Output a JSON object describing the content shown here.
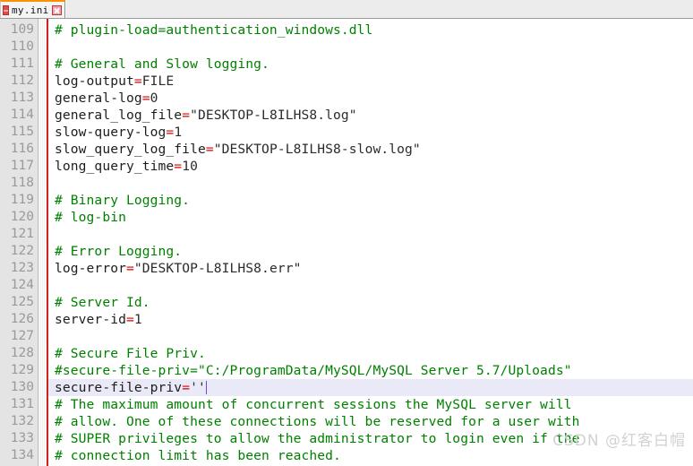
{
  "window": {
    "app": "text-editor",
    "title": "my.ini"
  },
  "tabbar": {
    "tabs": [
      {
        "label": "my.ini",
        "icon": "document-icon",
        "close_icon": "close-icon",
        "active": true
      }
    ]
  },
  "editor": {
    "first_line_number": 109,
    "current_line_number": 130,
    "gutter_line_numbers": [
      "109",
      "110",
      "111",
      "112",
      "113",
      "114",
      "115",
      "116",
      "117",
      "118",
      "119",
      "120",
      "121",
      "122",
      "123",
      "124",
      "125",
      "126",
      "127",
      "128",
      "129",
      "130",
      "131",
      "132",
      "133",
      "134"
    ],
    "colors": {
      "comment": "#008000",
      "operator": "#d40000",
      "text": "#1d1d1d",
      "current_line_bg": "#e9e9f7",
      "caret": "#6a4de0",
      "gutter_bg": "#e4e4e4",
      "gutter_text": "#9a9a9a",
      "margin_marker": "#d02020",
      "tab_accent": "#ff9000"
    },
    "lines": [
      {
        "n": "109",
        "tokens": [
          {
            "t": "comment",
            "s": "# plugin-load=authentication_windows.dll"
          }
        ]
      },
      {
        "n": "110",
        "tokens": [
          {
            "t": "blank",
            "s": ""
          }
        ]
      },
      {
        "n": "111",
        "tokens": [
          {
            "t": "comment",
            "s": "# General and Slow logging."
          }
        ]
      },
      {
        "n": "112",
        "tokens": [
          {
            "t": "key",
            "s": "log-output"
          },
          {
            "t": "eq",
            "s": "="
          },
          {
            "t": "val",
            "s": "FILE"
          }
        ]
      },
      {
        "n": "113",
        "tokens": [
          {
            "t": "key",
            "s": "general-log"
          },
          {
            "t": "eq",
            "s": "="
          },
          {
            "t": "val",
            "s": "0"
          }
        ]
      },
      {
        "n": "114",
        "tokens": [
          {
            "t": "key",
            "s": "general_log_file"
          },
          {
            "t": "eq",
            "s": "="
          },
          {
            "t": "val",
            "s": "\"DESKTOP-L8ILHS8.log\""
          }
        ]
      },
      {
        "n": "115",
        "tokens": [
          {
            "t": "key",
            "s": "slow-query-log"
          },
          {
            "t": "eq",
            "s": "="
          },
          {
            "t": "val",
            "s": "1"
          }
        ]
      },
      {
        "n": "116",
        "tokens": [
          {
            "t": "key",
            "s": "slow_query_log_file"
          },
          {
            "t": "eq",
            "s": "="
          },
          {
            "t": "val",
            "s": "\"DESKTOP-L8ILHS8-slow.log\""
          }
        ]
      },
      {
        "n": "117",
        "tokens": [
          {
            "t": "key",
            "s": "long_query_time"
          },
          {
            "t": "eq",
            "s": "="
          },
          {
            "t": "val",
            "s": "10"
          }
        ]
      },
      {
        "n": "118",
        "tokens": [
          {
            "t": "blank",
            "s": ""
          }
        ]
      },
      {
        "n": "119",
        "tokens": [
          {
            "t": "comment",
            "s": "# Binary Logging."
          }
        ]
      },
      {
        "n": "120",
        "tokens": [
          {
            "t": "comment",
            "s": "# log-bin"
          }
        ]
      },
      {
        "n": "121",
        "tokens": [
          {
            "t": "blank",
            "s": ""
          }
        ]
      },
      {
        "n": "122",
        "tokens": [
          {
            "t": "comment",
            "s": "# Error Logging."
          }
        ]
      },
      {
        "n": "123",
        "tokens": [
          {
            "t": "key",
            "s": "log-error"
          },
          {
            "t": "eq",
            "s": "="
          },
          {
            "t": "val",
            "s": "\"DESKTOP-L8ILHS8.err\""
          }
        ]
      },
      {
        "n": "124",
        "tokens": [
          {
            "t": "blank",
            "s": ""
          }
        ]
      },
      {
        "n": "125",
        "tokens": [
          {
            "t": "comment",
            "s": "# Server Id."
          }
        ]
      },
      {
        "n": "126",
        "tokens": [
          {
            "t": "key",
            "s": "server-id"
          },
          {
            "t": "eq",
            "s": "="
          },
          {
            "t": "val",
            "s": "1"
          }
        ]
      },
      {
        "n": "127",
        "tokens": [
          {
            "t": "blank",
            "s": ""
          }
        ]
      },
      {
        "n": "128",
        "tokens": [
          {
            "t": "comment",
            "s": "# Secure File Priv."
          }
        ]
      },
      {
        "n": "129",
        "tokens": [
          {
            "t": "comment",
            "s": "#secure-file-priv=\"C:/ProgramData/MySQL/MySQL Server 5.7/Uploads\""
          }
        ]
      },
      {
        "n": "130",
        "current": true,
        "caret": true,
        "tokens": [
          {
            "t": "key",
            "s": "secure-file-priv"
          },
          {
            "t": "eq",
            "s": "="
          },
          {
            "t": "val",
            "s": "''"
          }
        ]
      },
      {
        "n": "131",
        "tokens": [
          {
            "t": "comment",
            "s": "# The maximum amount of concurrent sessions the MySQL server will"
          }
        ]
      },
      {
        "n": "132",
        "tokens": [
          {
            "t": "comment",
            "s": "# allow. One of these connections will be reserved for a user with"
          }
        ]
      },
      {
        "n": "133",
        "tokens": [
          {
            "t": "comment",
            "s": "# SUPER privileges to allow the administrator to login even if the"
          }
        ]
      },
      {
        "n": "134",
        "tokens": [
          {
            "t": "comment",
            "s": "# connection limit has been reached."
          }
        ]
      }
    ]
  },
  "watermark": {
    "text": "CSDN @红客白帽"
  }
}
